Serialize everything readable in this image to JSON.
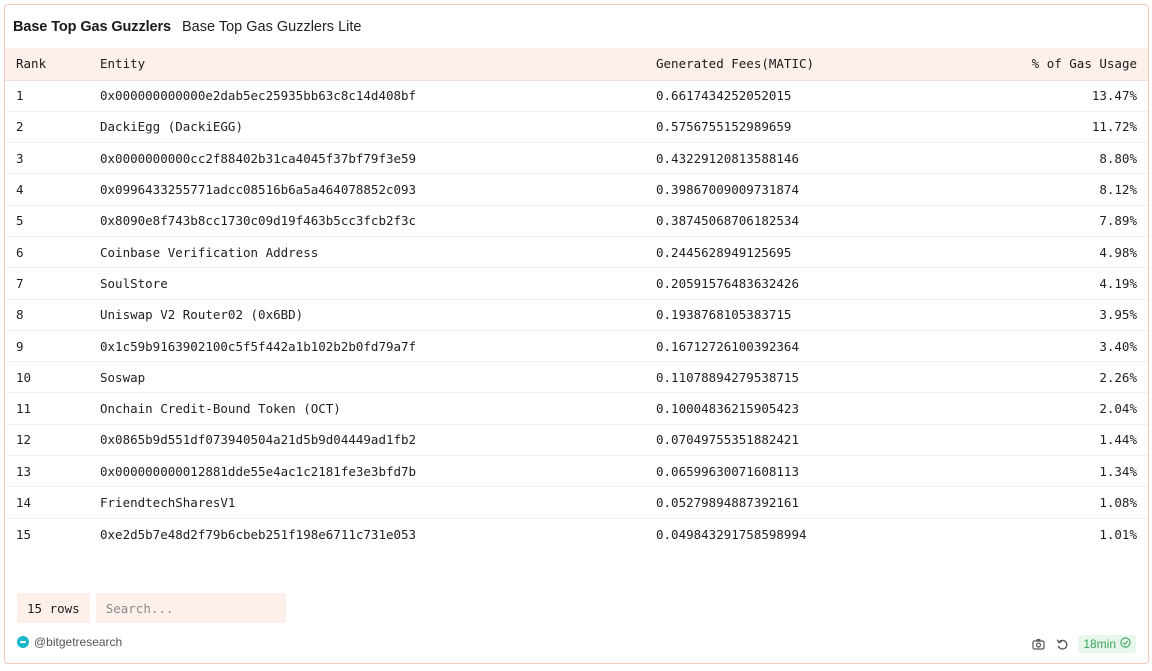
{
  "header": {
    "title": "Base Top Gas Guzzlers",
    "subtitle": "Base Top Gas Guzzlers Lite"
  },
  "table": {
    "columns": [
      "Rank",
      "Entity",
      "Generated Fees(MATIC)",
      "% of Gas Usage"
    ],
    "rows": [
      {
        "rank": "1",
        "entity": "0x000000000000e2dab5ec25935bb63c8c14d408bf",
        "fees": "0.6617434252052015",
        "pct": "13.47%"
      },
      {
        "rank": "2",
        "entity": "DackiEgg (DackiEGG)",
        "fees": "0.5756755152989659",
        "pct": "11.72%"
      },
      {
        "rank": "3",
        "entity": "0x0000000000cc2f88402b31ca4045f37bf79f3e59",
        "fees": "0.43229120813588146",
        "pct": "8.80%"
      },
      {
        "rank": "4",
        "entity": "0x0996433255771adcc08516b6a5a464078852c093",
        "fees": "0.39867009009731874",
        "pct": "8.12%"
      },
      {
        "rank": "5",
        "entity": "0x8090e8f743b8cc1730c09d19f463b5cc3fcb2f3c",
        "fees": "0.38745068706182534",
        "pct": "7.89%"
      },
      {
        "rank": "6",
        "entity": "Coinbase Verification Address",
        "fees": "0.2445628949125695",
        "pct": "4.98%"
      },
      {
        "rank": "7",
        "entity": "SoulStore",
        "fees": "0.20591576483632426",
        "pct": "4.19%"
      },
      {
        "rank": "8",
        "entity": "Uniswap V2 Router02 (0x6BD)",
        "fees": "0.1938768105383715",
        "pct": "3.95%"
      },
      {
        "rank": "9",
        "entity": "0x1c59b9163902100c5f5f442a1b102b2b0fd79a7f",
        "fees": "0.16712726100392364",
        "pct": "3.40%"
      },
      {
        "rank": "10",
        "entity": "Soswap",
        "fees": "0.11078894279538715",
        "pct": "2.26%"
      },
      {
        "rank": "11",
        "entity": "Onchain Credit-Bound Token (OCT)",
        "fees": "0.10004836215905423",
        "pct": "2.04%"
      },
      {
        "rank": "12",
        "entity": "0x0865b9d551df073940504a21d5b9d04449ad1fb2",
        "fees": "0.07049755351882421",
        "pct": "1.44%"
      },
      {
        "rank": "13",
        "entity": "0x000000000012881dde55e4ac1c2181fe3e3bfd7b",
        "fees": "0.06599630071608113",
        "pct": "1.34%"
      },
      {
        "rank": "14",
        "entity": "FriendtechSharesV1",
        "fees": "0.05279894887392161",
        "pct": "1.08%"
      },
      {
        "rank": "15",
        "entity": "0xe2d5b7e48d2f79b6cbeb251f198e6711c731e053",
        "fees": "0.049843291758598994",
        "pct": "1.01%"
      }
    ]
  },
  "footer": {
    "rows_count": "15 rows",
    "search_placeholder": "Search...",
    "author": "@bitgetresearch",
    "refresh_age": "18min",
    "icons": [
      "camera-icon",
      "refresh-icon",
      "check-circle-icon",
      "avatar-icon"
    ]
  },
  "colors": {
    "border": "#f3c9bd",
    "header_bg": "#fdf0ea",
    "badge_green": "#3aa35b"
  }
}
